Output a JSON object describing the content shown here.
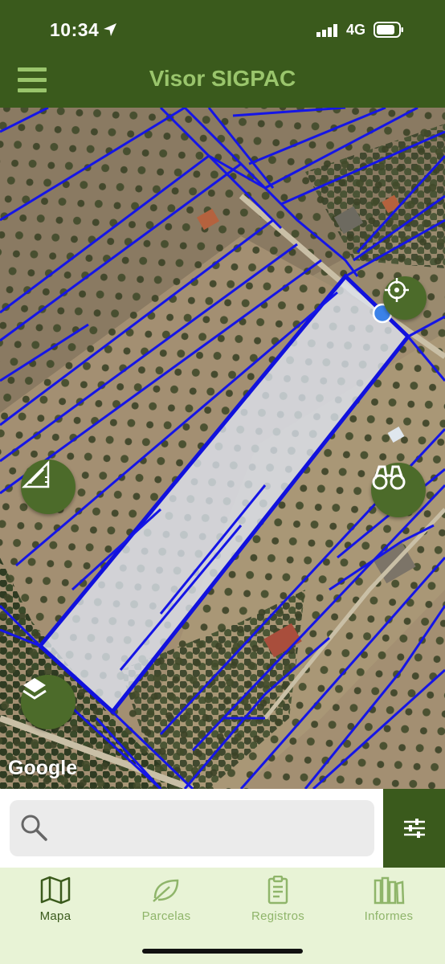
{
  "status_bar": {
    "time": "10:34",
    "network": "4G"
  },
  "app_bar": {
    "title": "Visor SIGPAC"
  },
  "map": {
    "attribution": "Google"
  },
  "search": {
    "placeholder": ""
  },
  "tabs": [
    {
      "label": "Mapa",
      "icon": "map-icon",
      "active": true
    },
    {
      "label": "Parcelas",
      "icon": "leaf-icon",
      "active": false
    },
    {
      "label": "Registros",
      "icon": "clipboard-icon",
      "active": false
    },
    {
      "label": "Informes",
      "icon": "books-icon",
      "active": false
    }
  ],
  "colors": {
    "header": "#3a5a1c",
    "title": "#9ac56c",
    "parcel_lines": "#1515e6",
    "tab_bar": "#e8f3d6",
    "tab_active": "#3a5a1c",
    "tab_inactive": "#8fb56a"
  }
}
